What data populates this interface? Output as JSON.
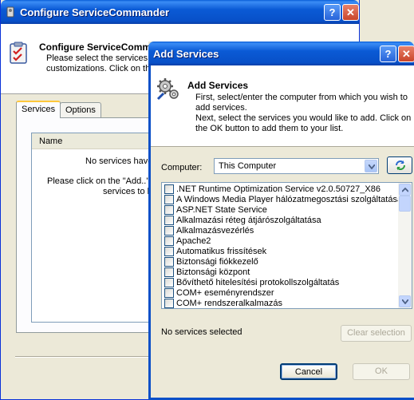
{
  "back_window": {
    "title": "Configure ServiceCommander",
    "help_label": "?",
    "close_label": "✕",
    "header_title": "Configure ServiceCommander",
    "header_desc": "Please select the services to customizations. Click on the",
    "tabs": [
      {
        "label": "Services"
      },
      {
        "label": "Options"
      }
    ],
    "list": {
      "column_name": "Name",
      "empty_line1": "No services have",
      "empty_line2": "Please click on the \"Add..\"",
      "empty_line3": "services to b"
    }
  },
  "dialog": {
    "title": "Add Services",
    "help_label": "?",
    "close_label": "✕",
    "header_title": "Add Services",
    "desc1": "First, select/enter the computer from which you wish to add services.",
    "desc2": "Next, select the services you would like to add. Click on the OK button to add them to your list.",
    "computer_label": "Computer:",
    "computer_value": "This Computer",
    "services": [
      ".NET Runtime Optimization Service v2.0.50727_X86",
      "A Windows Media Player hálózatmegosztási szolgáltatása",
      "ASP.NET State Service",
      "Alkalmazási réteg átjárószolgáltatása",
      "Alkalmazásvezérlés",
      "Apache2",
      "Automatikus frissítések",
      "Biztonsági fiókkezelő",
      "Biztonsági központ",
      "Bővíthető hitelesítési protokollszolgáltatás",
      "COM+ eseményrendszer",
      "COM+ rendszeralkalmazás"
    ],
    "selected_status": "No services selected",
    "clear_label": "Clear selection",
    "cancel_label": "Cancel",
    "ok_label": "OK"
  },
  "icons": {
    "app": "app-icon",
    "clipboard": "clipboard-check-icon",
    "gears": "gears-icon",
    "refresh": "refresh-icon",
    "dropdown": "chevron-down-icon"
  },
  "colors": {
    "titlebar": "#0a5ad5",
    "window_bg": "#ece9d8",
    "close": "#c9452a"
  }
}
